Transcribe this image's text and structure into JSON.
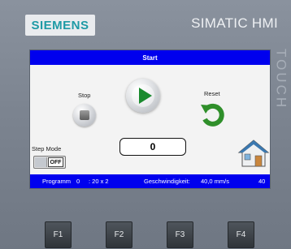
{
  "device": {
    "brand_logo": "SIEMENS",
    "brand_right": "SIMATIC HMI",
    "side_label": "TOUCH"
  },
  "screen": {
    "title": "Start",
    "stop_label": "Stop",
    "reset_label": "Reset",
    "step_mode_label": "Step Mode",
    "toggle_state": "OFF",
    "counter_value": "0"
  },
  "status": {
    "programm_label": "Programm",
    "programm_value": "0",
    "grid": ": 20 x 2",
    "speed_label": "Geschwindigkeit:",
    "speed_value": "40,0 mm/s",
    "speed_raw": "40"
  },
  "function_keys": [
    "F1",
    "F2",
    "F3",
    "F4"
  ],
  "colors": {
    "bar_blue": "#0000ee",
    "play_green": "#1a8a2e",
    "reset_green": "#2f8f2a",
    "house_roof": "#3a78b0"
  }
}
